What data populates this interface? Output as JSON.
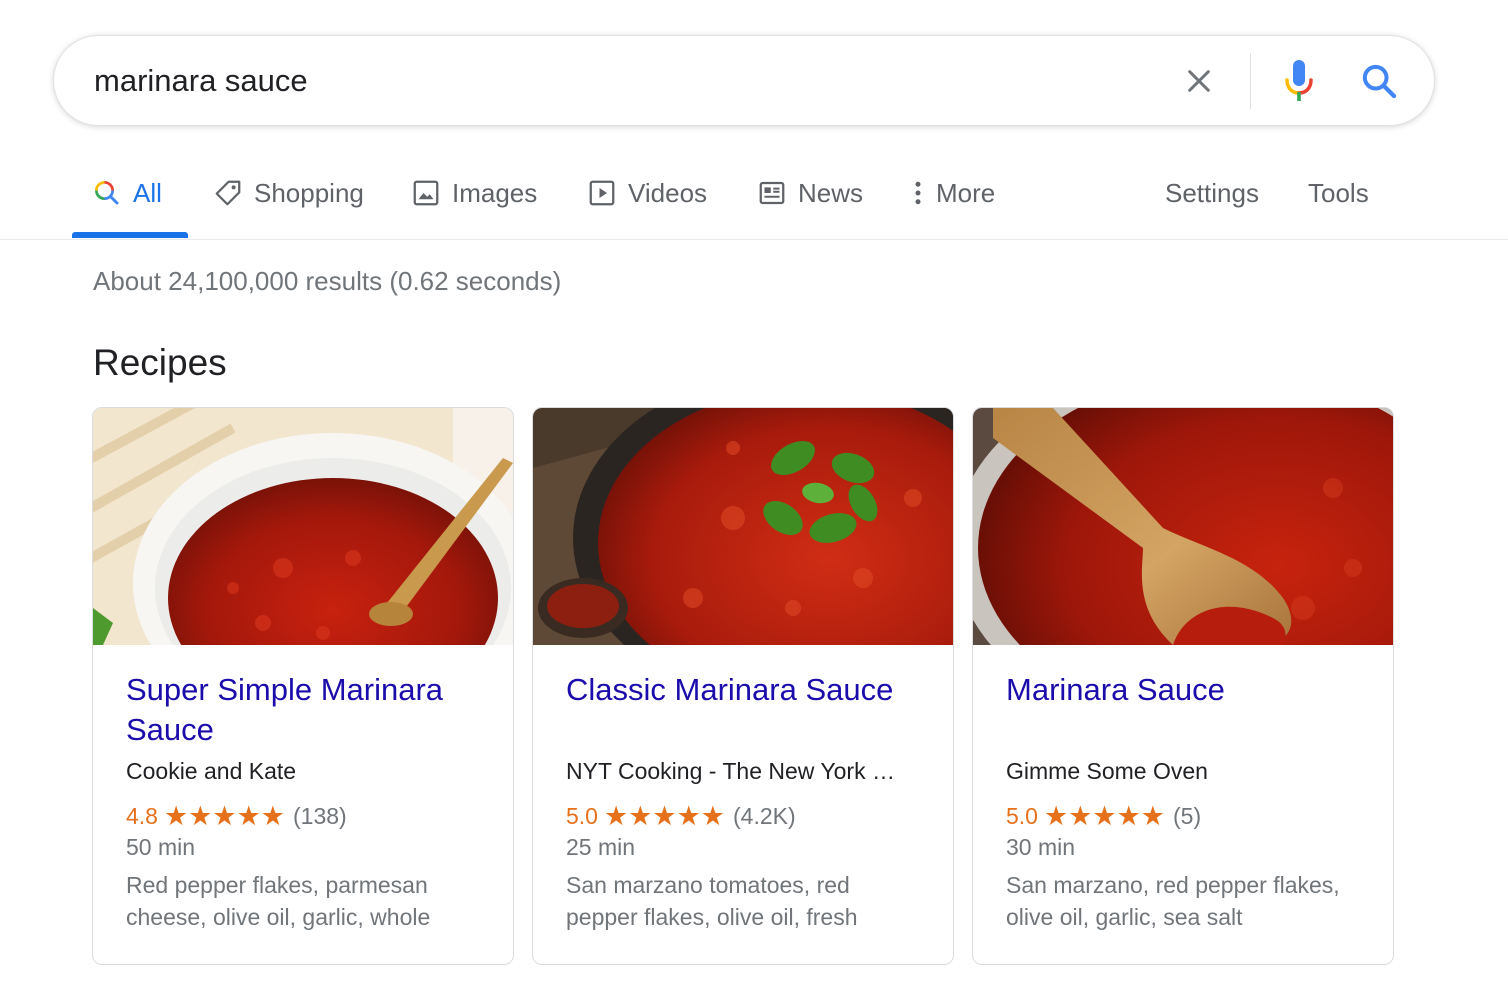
{
  "search": {
    "query": "marinara sauce",
    "clear_icon": "close-icon",
    "mic_icon": "microphone-icon",
    "search_icon": "search-icon"
  },
  "tabs": [
    {
      "label": "All",
      "icon": "search-multicolor-icon",
      "active": true
    },
    {
      "label": "Shopping",
      "icon": "tag-icon"
    },
    {
      "label": "Images",
      "icon": "image-icon"
    },
    {
      "label": "Videos",
      "icon": "play-icon"
    },
    {
      "label": "News",
      "icon": "newspaper-icon"
    },
    {
      "label": "More",
      "icon": "more-vertical-icon"
    }
  ],
  "tools": {
    "settings_label": "Settings",
    "tools_label": "Tools"
  },
  "results": {
    "stats": "About 24,100,000 results (0.62 seconds)"
  },
  "recipes": {
    "heading": "Recipes",
    "cards": [
      {
        "title": "Super Simple Marinara Sauce",
        "source": "Cookie and Kate",
        "rating": "4.8",
        "stars": "★★★★★",
        "count": "(138)",
        "time": "50 min",
        "ingredients": "Red pepper flakes, parmesan cheese, olive oil, garlic, whole"
      },
      {
        "title": "Classic Marinara Sauce",
        "source": "NYT Cooking - The New York …",
        "rating": "5.0",
        "stars": "★★★★★",
        "count": "(4.2K)",
        "time": "25 min",
        "ingredients": "San marzano tomatoes, red pepper flakes, olive oil, fresh"
      },
      {
        "title": "Marinara Sauce",
        "source": "Gimme Some Oven",
        "rating": "5.0",
        "stars": "★★★★★",
        "count": "(5)",
        "time": "30 min",
        "ingredients": "San marzano, red pepper flakes, olive oil, garlic, sea salt"
      }
    ]
  },
  "colors": {
    "link": "#1a0dab",
    "accent": "#1a73e8",
    "rating": "#e7711b",
    "muted": "#70757a"
  }
}
